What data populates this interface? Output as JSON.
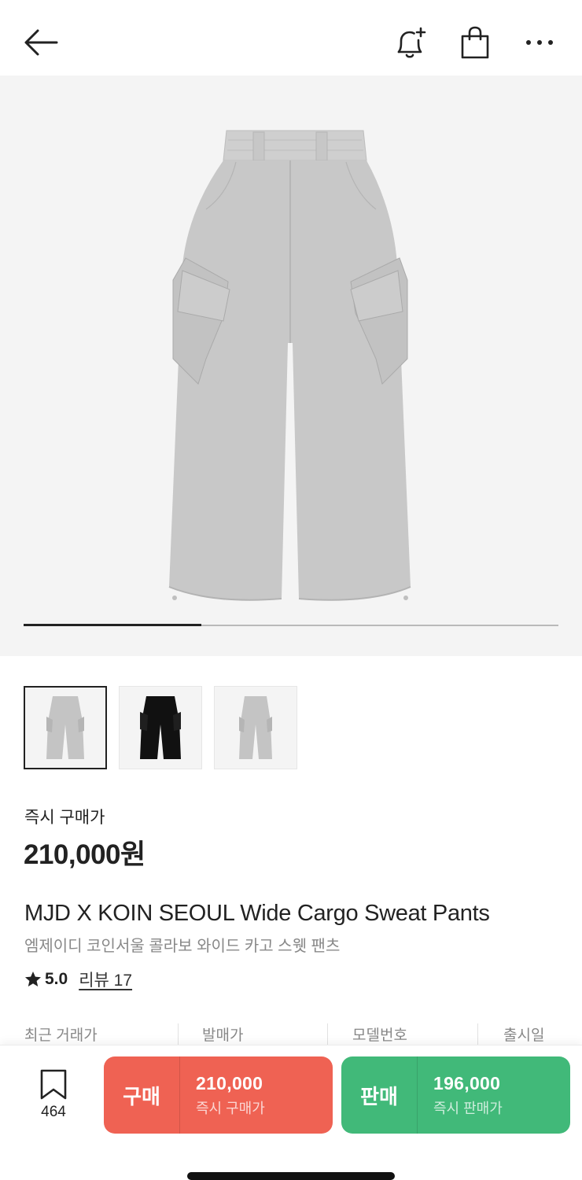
{
  "header": {
    "icons": [
      "arrow-left-icon",
      "bell-plus-icon",
      "shopping-bag-icon",
      "more-horizontal-icon"
    ]
  },
  "gallery": {
    "image_count": 3,
    "current_index": 1,
    "progress_fraction": 0.333
  },
  "thumbnails": [
    {
      "color": "#c4c4c4",
      "selected": true
    },
    {
      "color": "#111111",
      "selected": false
    },
    {
      "color": "#c4c4c4",
      "selected": false
    }
  ],
  "product": {
    "price_label": "즉시 구매가",
    "price": "210,000원",
    "name_en": "MJD X KOIN SEOUL Wide Cargo Sweat Pants",
    "name_ko": "엠제이디 코인서울 콜라보 와이드 카고 스웻 팬츠",
    "rating": "5.0",
    "review_link": "리뷰 17"
  },
  "meta": {
    "recent_price": "최근 거래가",
    "release_price": "발매가",
    "model_no": "모델번호",
    "release_date": "출시일"
  },
  "bottom_bar": {
    "wish_count": "464",
    "buy": {
      "title": "구매",
      "price": "210,000",
      "sub": "즉시 구매가",
      "color": "#ef6253"
    },
    "sell": {
      "title": "판매",
      "price": "196,000",
      "sub": "즉시 판매가",
      "color": "#41b979"
    }
  }
}
